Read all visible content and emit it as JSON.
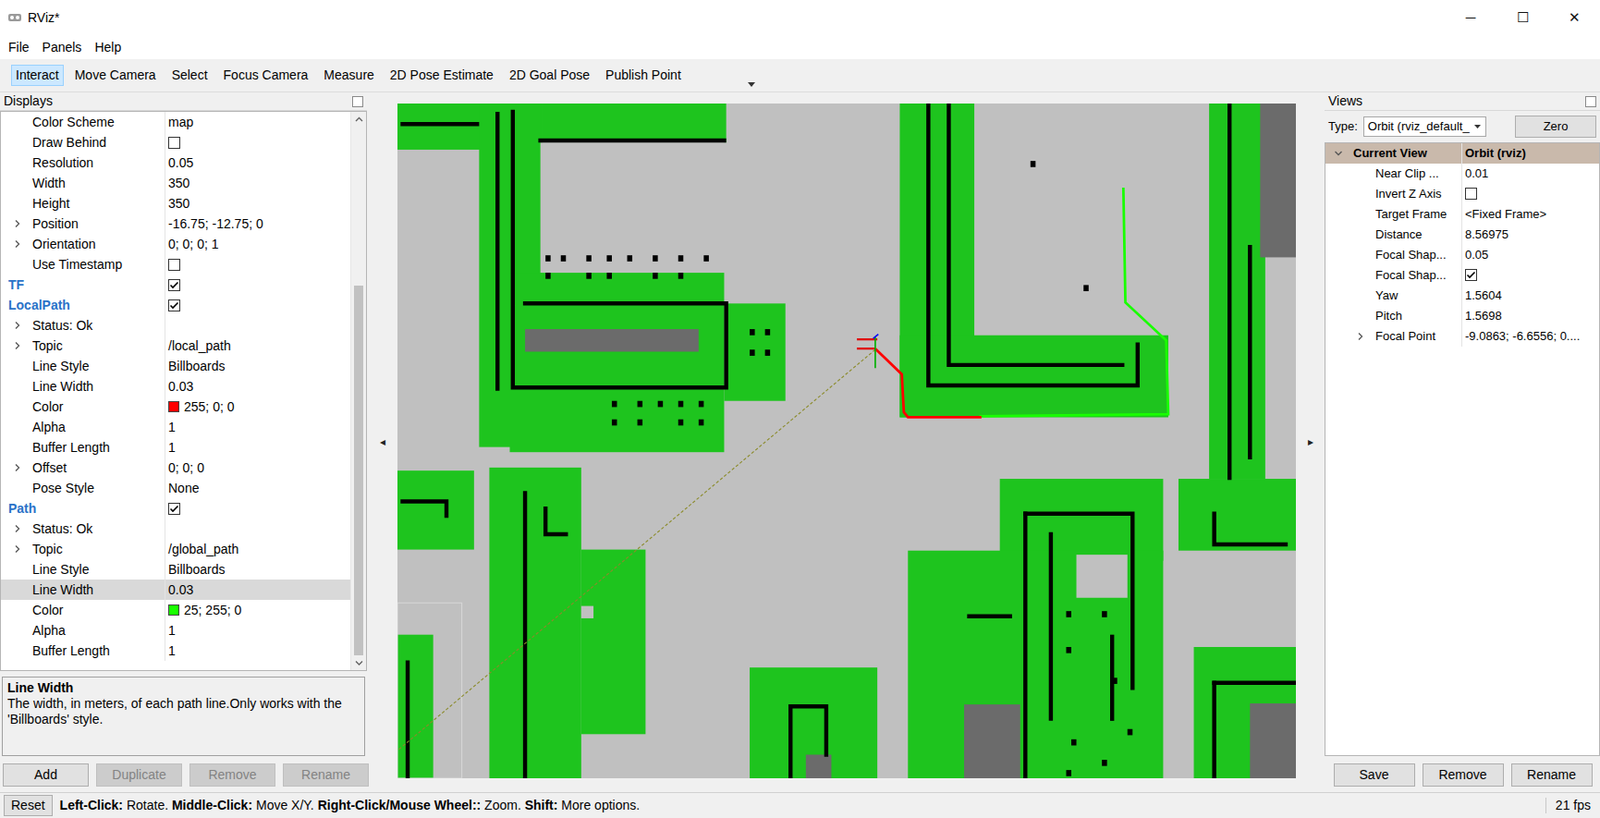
{
  "window": {
    "title": "RViz*",
    "controls": [
      "─",
      "☐",
      "✕"
    ]
  },
  "menu": [
    "File",
    "Panels",
    "Help"
  ],
  "toolbar": {
    "tools": [
      {
        "label": "Interact",
        "selected": true
      },
      {
        "label": "Move Camera",
        "selected": false
      },
      {
        "label": "Select",
        "selected": false
      },
      {
        "label": "Focus Camera",
        "selected": false
      },
      {
        "label": "Measure",
        "selected": false
      },
      {
        "label": "2D Pose Estimate",
        "selected": false
      },
      {
        "label": "2D Goal Pose",
        "selected": false
      },
      {
        "label": "Publish Point",
        "selected": false
      }
    ]
  },
  "displays": {
    "title": "Displays",
    "scroll": {
      "level": 1
    },
    "rows": [
      {
        "kind": "property",
        "label": "Color Scheme",
        "value": "map",
        "selected": false
      },
      {
        "kind": "checkbox",
        "label": "Draw Behind",
        "checked": false,
        "selected": false
      },
      {
        "kind": "property",
        "label": "Resolution",
        "value": "0.05",
        "selected": false
      },
      {
        "kind": "property",
        "label": "Width",
        "value": "350",
        "selected": false
      },
      {
        "kind": "property",
        "label": "Height",
        "value": "350",
        "selected": false
      },
      {
        "kind": "property",
        "label": "Position",
        "value": "-16.75; -12.75; 0",
        "expandable": true,
        "expanded": false,
        "selected": false
      },
      {
        "kind": "property",
        "label": "Orientation",
        "value": "0; 0; 0; 1",
        "expandable": true,
        "expanded": false,
        "selected": false
      },
      {
        "kind": "checkbox",
        "label": "Use Timestamp",
        "checked": false,
        "selected": false
      },
      {
        "kind": "display",
        "label": "TF",
        "checked": true,
        "selected": false
      },
      {
        "kind": "display",
        "label": "LocalPath",
        "checked": true,
        "selected": false
      },
      {
        "kind": "status",
        "label": "Status: Ok",
        "expandable": true,
        "expanded": false,
        "selected": false
      },
      {
        "kind": "property",
        "label": "Topic",
        "value": "/local_path",
        "expandable": true,
        "expanded": false,
        "selected": false
      },
      {
        "kind": "property",
        "label": "Line Style",
        "value": "Billboards",
        "selected": false
      },
      {
        "kind": "property",
        "label": "Line Width",
        "value": "0.03",
        "selected": false
      },
      {
        "kind": "color",
        "label": "Color",
        "value": "255; 0; 0",
        "color": "#ff0000",
        "selected": false
      },
      {
        "kind": "property",
        "label": "Alpha",
        "value": "1",
        "selected": false
      },
      {
        "kind": "property",
        "label": "Buffer Length",
        "value": "1",
        "selected": false
      },
      {
        "kind": "property",
        "label": "Offset",
        "value": "0; 0; 0",
        "expandable": true,
        "expanded": false,
        "selected": false
      },
      {
        "kind": "property",
        "label": "Pose Style",
        "value": "None",
        "selected": false
      },
      {
        "kind": "display",
        "label": "Path",
        "checked": true,
        "selected": false
      },
      {
        "kind": "status",
        "label": "Status: Ok",
        "expandable": true,
        "expanded": false,
        "selected": false
      },
      {
        "kind": "property",
        "label": "Topic",
        "value": "/global_path",
        "expandable": true,
        "expanded": false,
        "selected": false
      },
      {
        "kind": "property",
        "label": "Line Style",
        "value": "Billboards",
        "selected": false
      },
      {
        "kind": "property",
        "label": "Line Width",
        "value": "0.03",
        "selected": true
      },
      {
        "kind": "color",
        "label": "Color",
        "value": "25; 255; 0",
        "color": "#19ff00",
        "selected": false
      },
      {
        "kind": "property",
        "label": "Alpha",
        "value": "1",
        "selected": false
      },
      {
        "kind": "property",
        "label": "Buffer Length",
        "value": "1",
        "selected": false
      }
    ]
  },
  "description": {
    "title": "Line Width",
    "text": "The width, in meters, of each path line.Only works with the 'Billboards' style."
  },
  "display_buttons": [
    {
      "label": "Add",
      "disabled": false
    },
    {
      "label": "Duplicate",
      "disabled": true
    },
    {
      "label": "Remove",
      "disabled": true
    },
    {
      "label": "Rename",
      "disabled": true
    }
  ],
  "splitters": {
    "left": "◂",
    "right": "▸"
  },
  "views": {
    "title": "Views",
    "type_label": "Type:",
    "type_value": "Orbit (rviz_default_",
    "zero": "Zero",
    "rows": [
      {
        "kind": "category",
        "label": "Current View",
        "value": "Orbit (rviz)",
        "expandable": true,
        "expanded": true,
        "selected": false
      },
      {
        "kind": "property",
        "label": "Near Clip ...",
        "value": "0.01",
        "selected": false
      },
      {
        "kind": "checkbox",
        "label": "Invert Z Axis",
        "checked": false,
        "selected": false
      },
      {
        "kind": "property",
        "label": "Target Frame",
        "value": "<Fixed Frame>",
        "selected": false
      },
      {
        "kind": "property",
        "label": "Distance",
        "value": "8.56975",
        "selected": false
      },
      {
        "kind": "property",
        "label": "Focal Shap...",
        "value": "0.05",
        "selected": false
      },
      {
        "kind": "checkbox",
        "label": "Focal Shap...",
        "checked": true,
        "selected": false
      },
      {
        "kind": "property",
        "label": "Yaw",
        "value": "1.5604",
        "selected": false
      },
      {
        "kind": "property",
        "label": "Pitch",
        "value": "1.5698",
        "selected": false
      },
      {
        "kind": "property",
        "label": "Focal Point",
        "value": "-9.0863; -6.6556; 0....",
        "expandable": true,
        "expanded": false,
        "selected": false
      }
    ],
    "buttons": [
      "Save",
      "Remove",
      "Rename"
    ]
  },
  "status_bar": {
    "reset": "Reset",
    "hints": [
      {
        "text": "Left-Click:",
        "bold": true
      },
      {
        "text": " Rotate. ",
        "bold": false
      },
      {
        "text": "Middle-Click:",
        "bold": true
      },
      {
        "text": " Move X/Y. ",
        "bold": false
      },
      {
        "text": "Right-Click/Mouse Wheel::",
        "bold": true
      },
      {
        "text": " Zoom. ",
        "bold": false
      },
      {
        "text": "Shift:",
        "bold": true
      },
      {
        "text": " More options.",
        "bold": false
      }
    ],
    "fps": "21 fps"
  }
}
